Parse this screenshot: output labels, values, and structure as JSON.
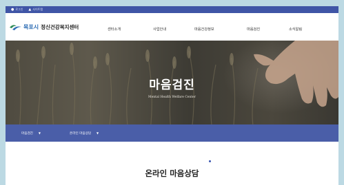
{
  "topbar": {
    "login_label": "로그인",
    "sitemap_label": "사이트맵"
  },
  "logo": {
    "city": "목포시",
    "name": "정신건강복지센터"
  },
  "gnb": [
    {
      "label": "센터소개"
    },
    {
      "label": "사업안내"
    },
    {
      "label": "마음건강정보"
    },
    {
      "label": "마음검진"
    },
    {
      "label": "소식알림"
    }
  ],
  "hero": {
    "title": "마음검진",
    "subtitle": "Mental Health Welfare Center"
  },
  "breadcrumb": [
    {
      "label": "마음검진"
    },
    {
      "label": "온라인 마음상담"
    }
  ],
  "main": {
    "heading": "온라인 마음상담"
  },
  "colors": {
    "topbar": "#3f55a6",
    "subnav": "#4a5ea8",
    "background": "#bcd9e3",
    "logo_city": "#2e6db5"
  }
}
